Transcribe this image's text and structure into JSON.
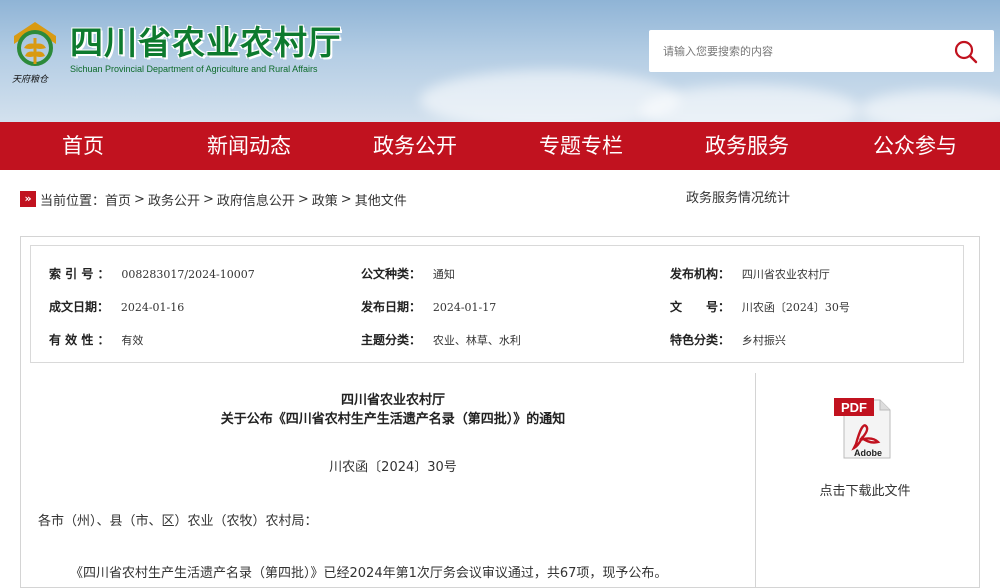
{
  "header": {
    "title": "四川省农业农村厅",
    "subtitle": "Sichuan Provincial Department of Agriculture and Rural Affairs",
    "emblem_caption": "天府粮仓",
    "search_placeholder": "请输入您要搜索的内容"
  },
  "nav": {
    "items": [
      "首页",
      "新闻动态",
      "政务公开",
      "专题专栏",
      "政务服务",
      "公众参与"
    ]
  },
  "breadcrumb": {
    "prefix": "当前位置：",
    "items": [
      "首页",
      "政务公开",
      "政府信息公开",
      "政策",
      "其他文件"
    ],
    "separator": ">"
  },
  "stats_link": "政务服务情况统计",
  "meta": {
    "index_label": "索 引 号 ：",
    "index_value": "008283017/2024-10007",
    "type_label": "公文种类：",
    "type_value": "通知",
    "issuer_label": "发布机构：",
    "issuer_value": "四川省农业农村厅",
    "created_label": "成文日期：",
    "created_value": "2024-01-16",
    "published_label": "发布日期：",
    "published_value": "2024-01-17",
    "docno_label": "文　　号：",
    "docno_value": "川农函〔2024〕30号",
    "validity_label": "有 效 性 ：",
    "validity_value": "有效",
    "topic_label": "主题分类：",
    "topic_value": "农业、林草、水利",
    "feature_label": "特色分类：",
    "feature_value": "乡村振兴"
  },
  "article": {
    "title_line1": "四川省农业农村厅",
    "title_line2": "关于公布《四川省农村生产生活遗产名录（第四批）》的通知",
    "doc_number": "川农函〔2024〕30号",
    "greeting": "各市（州）、县（市、区）农业（农牧）农村局：",
    "body_first": "《四川省农村生产生活遗产名录（第四批）》已经2024年第1次厅务会议审议通过，共67项，现予公布。"
  },
  "download": {
    "icon_label": "PDF",
    "brand": "Adobe",
    "caption": "点击下载此文件"
  },
  "colors": {
    "nav_red": "#c1121f",
    "title_green": "#0d7a2e"
  }
}
